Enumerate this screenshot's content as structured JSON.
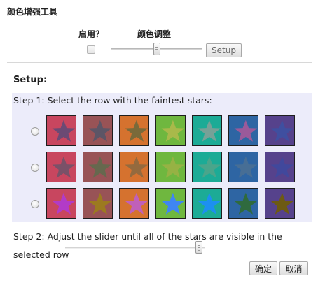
{
  "dialog": {
    "title": "颜色增强工具",
    "enable_label": "启用？",
    "adjust_label": "颜色调整",
    "setup_button": "Setup",
    "main_slider_value": 0.5,
    "enabled": false
  },
  "setup": {
    "heading": "Setup:",
    "step1": "Step 1: Select the row with the faintest stars:",
    "step2": "Step 2: Adjust the slider until all of the stars are visible in the selected row",
    "slider_value": 0.98,
    "rows": [
      {
        "selected": false,
        "swatches": [
          {
            "bg": "#c8465f",
            "star": "#6b4a74"
          },
          {
            "bg": "#985356",
            "star": "#5c5566"
          },
          {
            "bg": "#d5722f",
            "star": "#7a6a3a"
          },
          {
            "bg": "#6fb73f",
            "star": "#a9b94a"
          },
          {
            "bg": "#1cab96",
            "star": "#77a197"
          },
          {
            "bg": "#2e65a3",
            "star": "#9b5a9a"
          },
          {
            "bg": "#56428c",
            "star": "#3f4fa0"
          }
        ]
      },
      {
        "selected": false,
        "swatches": [
          {
            "bg": "#c8465f",
            "star": "#7a5168"
          },
          {
            "bg": "#985356",
            "star": "#66684e"
          },
          {
            "bg": "#d5722f",
            "star": "#946a3e"
          },
          {
            "bg": "#6fb73f",
            "star": "#96b244"
          },
          {
            "bg": "#1cab96",
            "star": "#4aa58b"
          },
          {
            "bg": "#2e65a3",
            "star": "#476e95"
          },
          {
            "bg": "#56428c",
            "star": "#41489c"
          }
        ]
      },
      {
        "selected": false,
        "swatches": [
          {
            "bg": "#c8465f",
            "star": "#b23bc7"
          },
          {
            "bg": "#985356",
            "star": "#9c7a20"
          },
          {
            "bg": "#d5722f",
            "star": "#c060b8"
          },
          {
            "bg": "#6fb73f",
            "star": "#3f86f2"
          },
          {
            "bg": "#1cab96",
            "star": "#1c90f0"
          },
          {
            "bg": "#2e65a3",
            "star": "#2f6a3e"
          },
          {
            "bg": "#56428c",
            "star": "#6d5a14"
          }
        ]
      }
    ]
  },
  "footer": {
    "ok": "确定",
    "cancel": "取消"
  }
}
